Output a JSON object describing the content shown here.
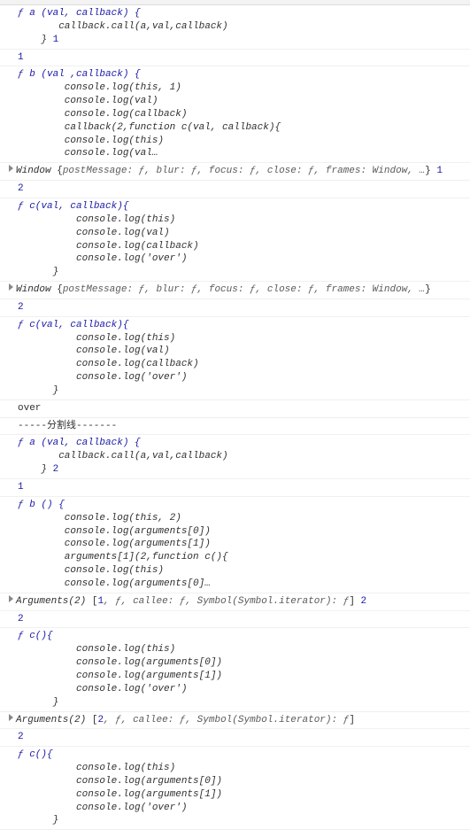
{
  "entries": [
    {
      "type": "func",
      "f": "ƒ ",
      "sig": "a (val, callback) {",
      "lines": [
        "       callback.call(a,val,callback)",
        "    }"
      ],
      "trail": " 1"
    },
    {
      "type": "num",
      "value": "1"
    },
    {
      "type": "func",
      "f": "ƒ ",
      "sig": "b (val ,callback) {",
      "lines": [
        "        console.log(this, 1)",
        "        console.log(val)",
        "        console.log(callback)",
        "        callback(2,function c(val, callback){",
        "        console.log(this)",
        "        console.log(val…"
      ]
    },
    {
      "type": "obj",
      "disclose": true,
      "text": "Window ",
      "after": "{",
      "props": "postMessage: ƒ, blur: ƒ, focus: ƒ, close: ƒ, frames: Window, …",
      "close": "}",
      "trail": " 1"
    },
    {
      "type": "num",
      "value": "2"
    },
    {
      "type": "func",
      "f": "ƒ ",
      "sig": "c(val, callback){",
      "lines": [
        "          console.log(this)",
        "          console.log(val)",
        "          console.log(callback)",
        "          console.log('over')",
        "      }"
      ]
    },
    {
      "type": "obj",
      "disclose": true,
      "text": "Window ",
      "after": "{",
      "props": "postMessage: ƒ, blur: ƒ, focus: ƒ, close: ƒ, frames: Window, …",
      "close": "}"
    },
    {
      "type": "num",
      "value": "2"
    },
    {
      "type": "func",
      "f": "ƒ ",
      "sig": "c(val, callback){",
      "lines": [
        "          console.log(this)",
        "          console.log(val)",
        "          console.log(callback)",
        "          console.log('over')",
        "      }"
      ]
    },
    {
      "type": "plain",
      "value": "over"
    },
    {
      "type": "plain",
      "value": "-----分割线-------"
    },
    {
      "type": "func",
      "f": "ƒ ",
      "sig": "a (val, callback) {",
      "lines": [
        "       callback.call(a,val,callback)",
        "    }"
      ],
      "trail": " 2"
    },
    {
      "type": "num",
      "value": "1"
    },
    {
      "type": "func",
      "f": "ƒ ",
      "sig": "b () {",
      "lines": [
        "        console.log(this, 2)",
        "        console.log(arguments[0])",
        "        console.log(arguments[1])",
        "        arguments[1](2,function c(){",
        "        console.log(this)",
        "        console.log(arguments[0]…"
      ]
    },
    {
      "type": "args",
      "disclose": true,
      "text": "Arguments(2) ",
      "after": "[",
      "inside": "1, ƒ, ",
      "props": "callee: ƒ, Symbol(Symbol.iterator): ƒ",
      "close": "]",
      "trail": " 2"
    },
    {
      "type": "num",
      "value": "2"
    },
    {
      "type": "func",
      "f": "ƒ ",
      "sig": "c(){",
      "lines": [
        "          console.log(this)",
        "          console.log(arguments[0])",
        "          console.log(arguments[1])",
        "          console.log('over')",
        "      }"
      ]
    },
    {
      "type": "args",
      "disclose": true,
      "text": "Arguments(2) ",
      "after": "[",
      "inside": "2, ƒ, ",
      "props": "callee: ƒ, Symbol(Symbol.iterator): ƒ",
      "close": "]"
    },
    {
      "type": "num",
      "value": "2"
    },
    {
      "type": "func",
      "f": "ƒ ",
      "sig": "c(){",
      "lines": [
        "          console.log(this)",
        "          console.log(arguments[0])",
        "          console.log(arguments[1])",
        "          console.log('over')",
        "      }"
      ]
    }
  ]
}
